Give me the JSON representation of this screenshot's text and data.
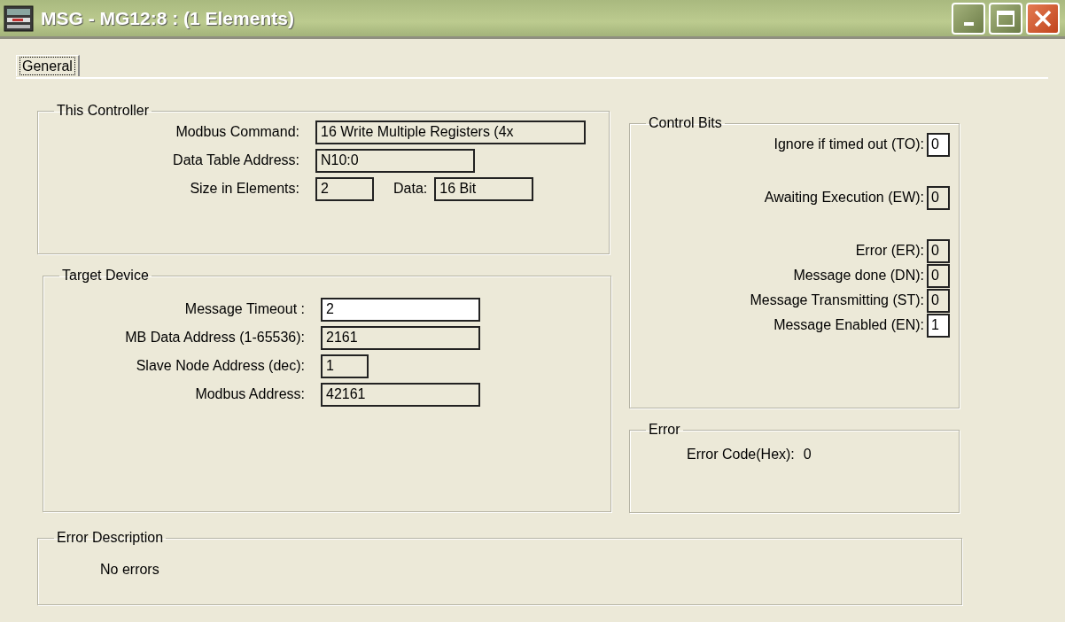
{
  "window": {
    "title": "MSG - MG12:8 : (1 Elements)"
  },
  "tabs": [
    {
      "label": "General",
      "selected": true
    }
  ],
  "this_controller": {
    "title": "This Controller",
    "rows": [
      {
        "fields": [
          {
            "label": "Modbus Command:",
            "value": "16 Write Multiple Registers (4x",
            "editable": false
          }
        ]
      },
      {
        "fields": [
          {
            "label": "Data Table Address:",
            "value": "N10:0",
            "editable": false
          }
        ]
      },
      {
        "fields": [
          {
            "label": "Size in Elements:",
            "value": "2",
            "editable": false
          },
          {
            "label": "Data:",
            "value": "16 Bit",
            "editable": false
          }
        ]
      }
    ]
  },
  "target_device": {
    "title": "Target Device",
    "rows": [
      {
        "fields": [
          {
            "label": "Message Timeout :",
            "value": "2",
            "editable": true
          }
        ]
      },
      {
        "fields": [
          {
            "label": "MB Data Address (1-65536):",
            "value": "2161",
            "editable": false
          }
        ]
      },
      {
        "fields": [
          {
            "label": "Slave Node Address (dec):",
            "value": "1",
            "editable": false
          }
        ]
      },
      {
        "fields": [
          {
            "label": "Modbus Address:",
            "value": "42161",
            "editable": false
          }
        ]
      }
    ]
  },
  "control_bits": {
    "title": "Control Bits",
    "bits": [
      {
        "label": "Ignore if timed out (TO):",
        "value": "0",
        "editable": true
      },
      {
        "label": "Awaiting Execution (EW):",
        "value": "0",
        "editable": false
      },
      {
        "label": "Error (ER):",
        "value": "0",
        "editable": false
      },
      {
        "label": "Message done (DN):",
        "value": "0",
        "editable": false
      },
      {
        "label": "Message Transmitting (ST):",
        "value": "0",
        "editable": false
      },
      {
        "label": "Message Enabled (EN):",
        "value": "1",
        "editable": true
      }
    ]
  },
  "error": {
    "title": "Error",
    "label": "Error Code(Hex):",
    "value": "0"
  },
  "error_description": {
    "title": "Error Description",
    "text": "No errors"
  }
}
